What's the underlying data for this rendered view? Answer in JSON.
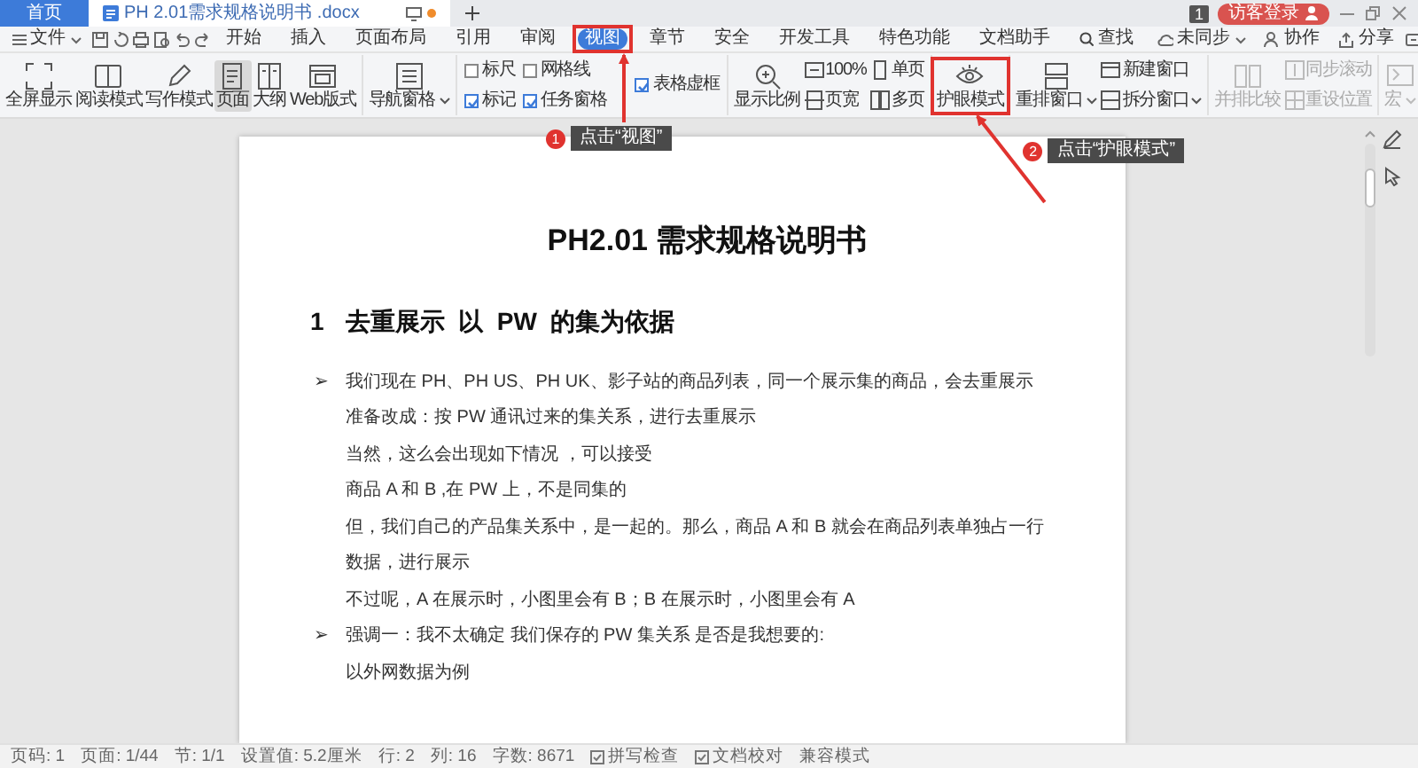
{
  "title_bar": {
    "tabs": [
      {
        "label": "首页",
        "kind": "home",
        "selected": false,
        "modified": false
      },
      {
        "label": "PH 2.01需求规格说明书 .docx",
        "kind": "document",
        "selected": true,
        "modified": true
      }
    ],
    "notice_count": "1",
    "login_button": "访客登录"
  },
  "menu_bar": {
    "file_label": "文件",
    "items": [
      {
        "label": "开始",
        "selected": false,
        "highlighted": false
      },
      {
        "label": "插入",
        "selected": false,
        "highlighted": false
      },
      {
        "label": "页面布局",
        "selected": false,
        "highlighted": false
      },
      {
        "label": "引用",
        "selected": false,
        "highlighted": false
      },
      {
        "label": "审阅",
        "selected": false,
        "highlighted": false
      },
      {
        "label": "视图",
        "selected": true,
        "highlighted": true
      },
      {
        "label": "章节",
        "selected": false,
        "highlighted": false
      },
      {
        "label": "安全",
        "selected": false,
        "highlighted": false
      },
      {
        "label": "开发工具",
        "selected": false,
        "highlighted": false
      },
      {
        "label": "特色功能",
        "selected": false,
        "highlighted": false
      },
      {
        "label": "文档助手",
        "selected": false,
        "highlighted": false
      }
    ],
    "search_label": "查找",
    "right_items": [
      "未同步",
      "协作",
      "分享"
    ]
  },
  "ribbon": {
    "groups": [
      {
        "columns": [
          [
            {
              "kind": "large",
              "label": "全屏显示",
              "selected": false,
              "disabled": false,
              "dropdown": false,
              "highlighted": false
            }
          ],
          [
            {
              "kind": "large",
              "label": "阅读模式",
              "selected": false,
              "disabled": false,
              "dropdown": false,
              "highlighted": false
            }
          ],
          [
            {
              "kind": "large",
              "label": "写作模式",
              "selected": false,
              "disabled": false,
              "dropdown": false,
              "highlighted": false
            }
          ],
          [
            {
              "kind": "large",
              "label": "页面",
              "selected": true,
              "disabled": false,
              "dropdown": false,
              "highlighted": false
            }
          ],
          [
            {
              "kind": "large",
              "label": "大纲",
              "selected": false,
              "disabled": false,
              "dropdown": false,
              "highlighted": false
            }
          ],
          [
            {
              "kind": "large",
              "label": "Web版式",
              "selected": false,
              "disabled": false,
              "dropdown": false,
              "highlighted": false
            }
          ]
        ]
      },
      {
        "columns": [
          [
            {
              "kind": "large",
              "label": "导航窗格",
              "selected": false,
              "disabled": false,
              "dropdown": true,
              "highlighted": false
            }
          ]
        ]
      },
      {
        "columns": [
          [
            {
              "kind": "checkbox",
              "label": "标尺",
              "checked": false,
              "disabled": false
            },
            {
              "kind": "checkbox",
              "label": "标记",
              "checked": true,
              "disabled": false
            }
          ],
          [
            {
              "kind": "checkbox",
              "label": "网格线",
              "checked": false,
              "disabled": false
            },
            {
              "kind": "checkbox",
              "label": "任务窗格",
              "checked": true,
              "disabled": false
            }
          ],
          [
            {
              "kind": "checkbox",
              "label": "表格虚框",
              "checked": true,
              "disabled": false
            }
          ]
        ]
      },
      {
        "columns": [
          [
            {
              "kind": "large",
              "label": "显示比例",
              "selected": false,
              "disabled": false,
              "dropdown": false,
              "highlighted": false
            }
          ],
          [
            {
              "kind": "small",
              "label": "100%",
              "disabled": false,
              "dropdown": false
            },
            {
              "kind": "small",
              "label": "页宽",
              "disabled": false,
              "dropdown": false
            }
          ],
          [
            {
              "kind": "small",
              "label": "单页",
              "disabled": false,
              "dropdown": false
            },
            {
              "kind": "small",
              "label": "多页",
              "disabled": false,
              "dropdown": false
            }
          ]
        ]
      },
      {
        "columns": [
          [
            {
              "kind": "large",
              "label": "护眼模式",
              "selected": false,
              "disabled": false,
              "dropdown": false,
              "highlighted": true
            }
          ]
        ]
      },
      {
        "columns": [
          [
            {
              "kind": "large",
              "label": "重排窗口",
              "selected": false,
              "disabled": false,
              "dropdown": true,
              "highlighted": false
            }
          ],
          [
            {
              "kind": "small",
              "label": "新建窗口",
              "disabled": false,
              "dropdown": false
            },
            {
              "kind": "small",
              "label": "拆分窗口",
              "disabled": false,
              "dropdown": true
            }
          ]
        ]
      },
      {
        "columns": [
          [
            {
              "kind": "large",
              "label": "并排比较",
              "selected": false,
              "disabled": true,
              "dropdown": false,
              "highlighted": false
            }
          ],
          [
            {
              "kind": "small",
              "label": "同步滚动",
              "disabled": true,
              "dropdown": false
            },
            {
              "kind": "small",
              "label": "重设位置",
              "disabled": true,
              "dropdown": false
            }
          ]
        ]
      },
      {
        "columns": [
          [
            {
              "kind": "large",
              "label": "宏",
              "selected": false,
              "disabled": true,
              "dropdown": true,
              "highlighted": false
            }
          ]
        ]
      }
    ]
  },
  "annotations": [
    {
      "number": "1",
      "text": "点击“视图”"
    },
    {
      "number": "2",
      "text": "点击“护眼模式”"
    }
  ],
  "document": {
    "title": "PH2.01 需求规格说明书",
    "heading_number": "1",
    "heading": "去重展示  以  PW  的集为依据",
    "paragraphs": [
      {
        "kind": "bullet",
        "marker": "➢",
        "text": "我们现在 PH、PH US、PH UK、影子站的商品列表，同一个展示集的商品，会去重展示"
      },
      {
        "kind": "plain",
        "text": "准备改成：按 PW 通讯过来的集关系，进行去重展示"
      },
      {
        "kind": "plain",
        "text": "当然，这么会出现如下情况 ，可以接受"
      },
      {
        "kind": "plain",
        "text": "商品 A 和 B ,在 PW 上，不是同集的"
      },
      {
        "kind": "plain",
        "text": "但，我们自己的产品集关系中，是一起的。那么，商品 A 和 B 就会在商品列表单独占一行"
      },
      {
        "kind": "plain",
        "text": "数据，进行展示"
      },
      {
        "kind": "plain",
        "text": "不过呢，A 在展示时，小图里会有 B；B 在展示时，小图里会有 A"
      },
      {
        "kind": "bullet",
        "marker": "➢",
        "text": "强调一：我不太确定 我们保存的 PW 集关系 是否是我想要的:"
      },
      {
        "kind": "plain",
        "text": "以外网数据为例"
      }
    ]
  },
  "status_bar": [
    {
      "kind": "text",
      "label": "页码: 1"
    },
    {
      "kind": "text",
      "label": "页面: 1/44"
    },
    {
      "kind": "text",
      "label": "节: 1/1"
    },
    {
      "kind": "text",
      "label": "设置值: 5.2厘米"
    },
    {
      "kind": "text",
      "label": "行: 2"
    },
    {
      "kind": "text",
      "label": "列: 16"
    },
    {
      "kind": "text",
      "label": "字数: 8671"
    },
    {
      "kind": "check",
      "label": "拼写检查"
    },
    {
      "kind": "check",
      "label": "文档校对"
    },
    {
      "kind": "text",
      "label": "兼容模式"
    }
  ]
}
